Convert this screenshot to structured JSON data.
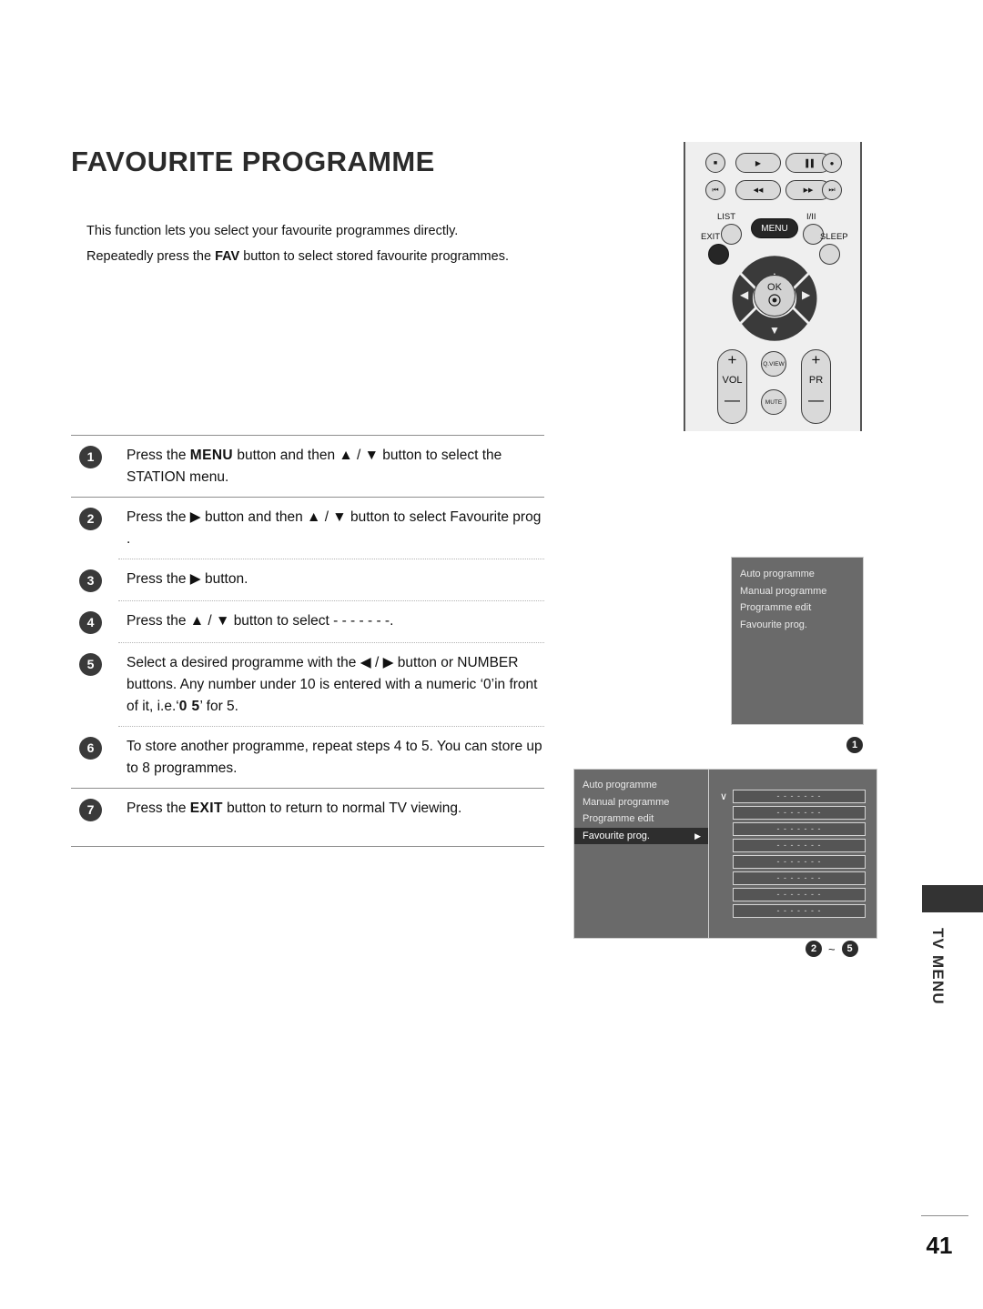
{
  "page": {
    "title": "FAVOURITE PROGRAMME",
    "number": "41",
    "side_label": "TV MENU"
  },
  "intro": {
    "line1": "This function lets you select your favourite programmes directly.",
    "line2_before": "Repeatedly press the ",
    "line2_bold": "FAV",
    "line2_after": " button to select stored favourite programmes."
  },
  "steps": [
    {
      "num": "1",
      "parts": [
        {
          "t": "Press the "
        },
        {
          "t": "MENU",
          "b": true
        },
        {
          "t": " button and then ▲ / ▼ button to select the STATION menu."
        }
      ]
    },
    {
      "num": "2",
      "parts": [
        {
          "t": "Press the ▶ button and then ▲ / ▼ button to select Favourite prog   ."
        }
      ]
    },
    {
      "num": "3",
      "parts": [
        {
          "t": "Press the ▶ button."
        }
      ]
    },
    {
      "num": "4",
      "parts": [
        {
          "t": "Press the ▲ / ▼ button to select - -  - - - - -."
        }
      ]
    },
    {
      "num": "5",
      "parts": [
        {
          "t": "Select a desired programme with the ◀ / ▶ button or NUMBER buttons. Any number under 10 is entered with a numeric ‘0’in front of it, i.e.‘"
        },
        {
          "t": "0 5",
          "b": true
        },
        {
          "t": "’ for 5."
        }
      ]
    },
    {
      "num": "6",
      "parts": [
        {
          "t": "To store another programme, repeat steps 4  to 5. You can store up to 8 programmes."
        }
      ]
    },
    {
      "num": "7",
      "parts": [
        {
          "t": "Press the "
        },
        {
          "t": "EXIT",
          "b": true
        },
        {
          "t": " button to return to normal TV viewing."
        }
      ]
    }
  ],
  "remote": {
    "labels": {
      "list": "LIST",
      "menu": "MENU",
      "i_ii": "I/II",
      "exit": "EXIT",
      "sleep": "SLEEP",
      "ok": "OK",
      "vol": "VOL",
      "pr": "PR",
      "qview": "Q.VIEW",
      "mute": "MUTE",
      "plus": "+",
      "minus": "—"
    },
    "transport": {
      "stop": "■",
      "play": "▶",
      "pause": "▐▐",
      "record": "●",
      "prev": "⏮",
      "rewind": "◀◀",
      "forward": "▶▶",
      "next": "⏭"
    },
    "dpad": {
      "up": "▲",
      "down": "▼",
      "left": "◀",
      "right": "▶"
    }
  },
  "osd1": {
    "items": [
      "Auto programme",
      "Manual programme",
      "Programme edit",
      "Favourite prog."
    ]
  },
  "osd2": {
    "items": [
      {
        "label": "Auto programme",
        "selected": false
      },
      {
        "label": "Manual programme",
        "selected": false
      },
      {
        "label": "Programme edit",
        "selected": false
      },
      {
        "label": "Favourite prog.",
        "selected": true,
        "arrow": "▶"
      }
    ],
    "check": "∨",
    "slots": [
      "- -      - - - - -",
      "- -      - - - - -",
      "- -      - - - - -",
      "- -      - - - - -",
      "- -      - - - - -",
      "- -      - - - - -",
      "- -      - - - - -",
      "- -      - - - - -"
    ]
  },
  "markers": {
    "first": "1",
    "range_from": "2",
    "range_tilde": "~",
    "range_to": "5"
  }
}
